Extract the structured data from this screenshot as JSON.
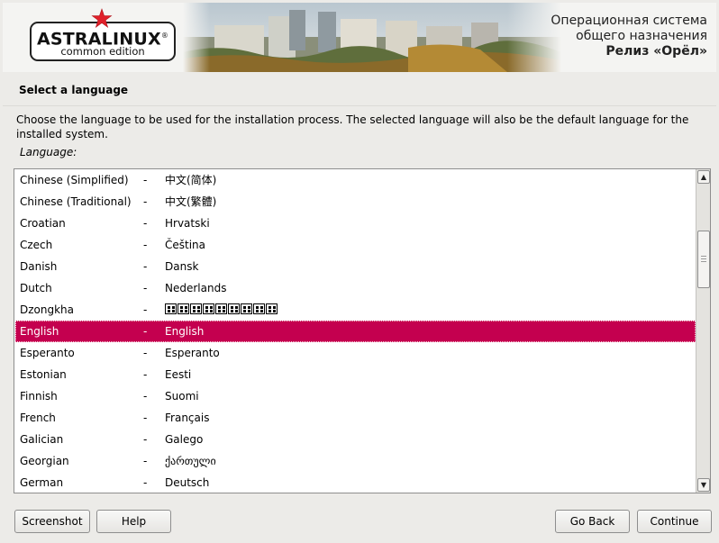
{
  "banner": {
    "logo_text": "ASTRALINUX",
    "logo_reg": "®",
    "logo_subtitle": "common edition",
    "release_line1": "Операционная система",
    "release_line2": "общего назначения",
    "release_name": "Релиз «Орёл»"
  },
  "page": {
    "title": "Select a language",
    "description": "Choose the language to be used for the installation process. The selected language will also be the default language for the installed system.",
    "field_label": "Language:"
  },
  "languages": [
    {
      "name": "Chinese (Simplified)",
      "dash": "-",
      "native": "中文(简体)"
    },
    {
      "name": "Chinese (Traditional)",
      "dash": "-",
      "native": "中文(繁體)"
    },
    {
      "name": "Croatian",
      "dash": "-",
      "native": "Hrvatski"
    },
    {
      "name": "Czech",
      "dash": "-",
      "native": "Čeština"
    },
    {
      "name": "Danish",
      "dash": "-",
      "native": "Dansk"
    },
    {
      "name": "Dutch",
      "dash": "-",
      "native": "Nederlands"
    },
    {
      "name": "Dzongkha",
      "dash": "-",
      "native": ""
    },
    {
      "name": "English",
      "dash": "-",
      "native": "English"
    },
    {
      "name": "Esperanto",
      "dash": "-",
      "native": "Esperanto"
    },
    {
      "name": "Estonian",
      "dash": "-",
      "native": "Eesti"
    },
    {
      "name": "Finnish",
      "dash": "-",
      "native": "Suomi"
    },
    {
      "name": "French",
      "dash": "-",
      "native": "Français"
    },
    {
      "name": "Galician",
      "dash": "-",
      "native": "Galego"
    },
    {
      "name": "Georgian",
      "dash": "-",
      "native": "ქართული"
    },
    {
      "name": "German",
      "dash": "-",
      "native": "Deutsch"
    }
  ],
  "selected_language": "English",
  "colors": {
    "selection": "#c4004f",
    "logo_star": "#e0202a"
  },
  "icons": {
    "scroll_up": "▲",
    "scroll_down": "▼"
  },
  "buttons": {
    "screenshot": "Screenshot",
    "help": "Help",
    "go_back": "Go Back",
    "continue": "Continue"
  }
}
